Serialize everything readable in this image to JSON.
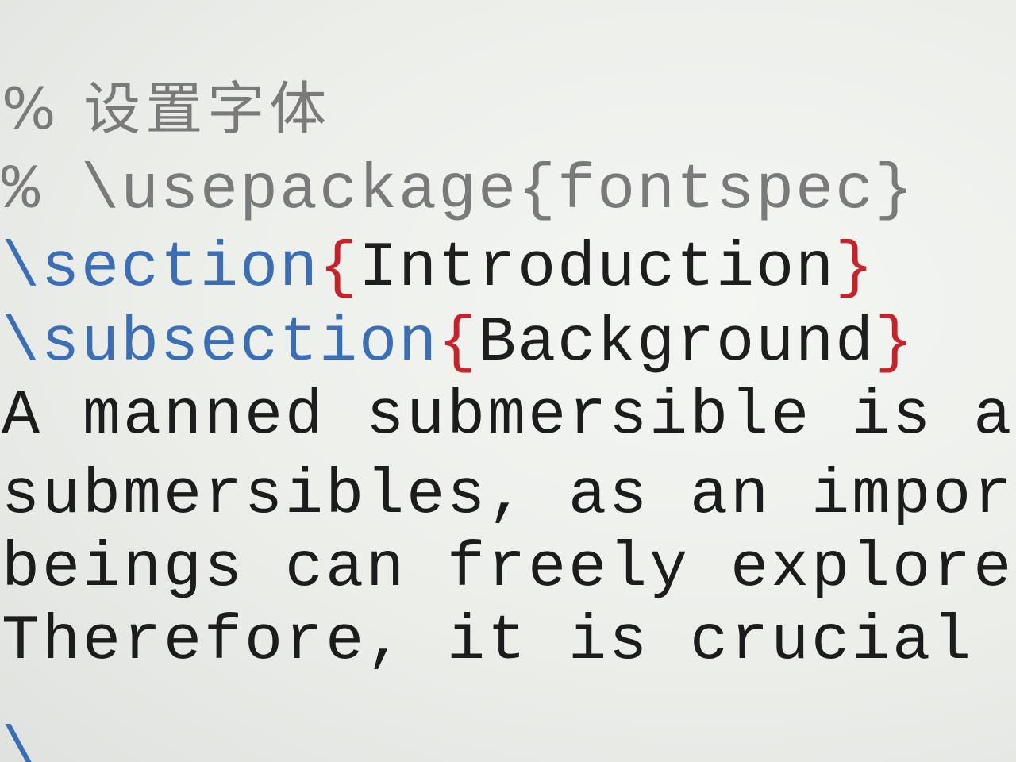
{
  "editor": {
    "lines": {
      "comment_fonts": "% 设置字体",
      "comment_package": "% \\usepackage{fontspec}",
      "section_cmd": "\\section",
      "section_open": "{",
      "section_arg": "Introduction",
      "section_close": "}",
      "subsection_cmd": "\\subsection",
      "subsection_open": "{",
      "subsection_arg": "Background",
      "subsection_close": "}",
      "body_1": "A manned submersible is a device",
      "body_2": "submersibles, as an important de",
      "body_3": "beings can freely explore the se",
      "body_4": "Therefore, it is crucial to esta",
      "partial_next": "\\"
    }
  }
}
